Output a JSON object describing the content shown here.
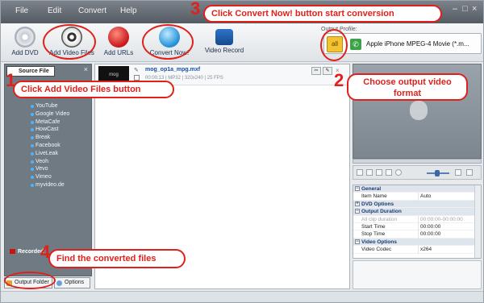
{
  "menu": [
    "File",
    "Edit",
    "Convert",
    "Help"
  ],
  "window_controls": {
    "minimize": "–",
    "maximize": "□",
    "close": "×"
  },
  "toolbar": {
    "add_dvd": "Add DVD",
    "add_video_files": "Add Video Files",
    "add_urls": "Add URLs",
    "convert_now": "Convert Now!",
    "video_record": "Video Record"
  },
  "output_profile": {
    "label": "Output Profile:",
    "all_label": "all",
    "value": "Apple iPhone MPEG-4 Movie (*.m..."
  },
  "left_panel": {
    "title": "Source File",
    "items": [
      "YouTube",
      "Google Video",
      "MetaCafe",
      "HowCast",
      "Break",
      "Facebook",
      "LiveLeak",
      "Veoh",
      "Vevo",
      "Vimeo",
      "myvideo.de"
    ],
    "recorded": "Recorded",
    "tabs": [
      "Output Folder",
      "Options"
    ]
  },
  "file": {
    "name": "mog_op1a_mpg.mxf",
    "meta": "00:00:13  |  MP32 | 320x240 | 25 FPS",
    "thumb_text": "mog"
  },
  "properties": [
    {
      "type": "group",
      "label": "General",
      "sign": "−"
    },
    {
      "type": "row",
      "key": "Item Name",
      "value": "Auto"
    },
    {
      "type": "group",
      "label": "DVD Options",
      "sign": "+"
    },
    {
      "type": "group",
      "label": "Output Duration",
      "sign": "−"
    },
    {
      "type": "row",
      "key": "All clip duration",
      "value": "00:00:00-00:00:00",
      "dim": true
    },
    {
      "type": "row",
      "key": "Start Time",
      "value": "00:00:00"
    },
    {
      "type": "row",
      "key": "Stop Time",
      "value": "00:00:00"
    },
    {
      "type": "group",
      "label": "Video Options",
      "sign": "−"
    },
    {
      "type": "row",
      "key": "Video Codec",
      "value": "x264"
    }
  ],
  "annotations": {
    "n1": "1",
    "t1": "Click  Add Video Files button",
    "n2": "2",
    "t2": "Choose output video format",
    "n3": "3",
    "t3": "Click Convert Now!  button start conversion",
    "n4": "4",
    "t4": "Find the converted files"
  },
  "colors": {
    "annotation": "#e0201b",
    "menubar": "#5f666e"
  }
}
